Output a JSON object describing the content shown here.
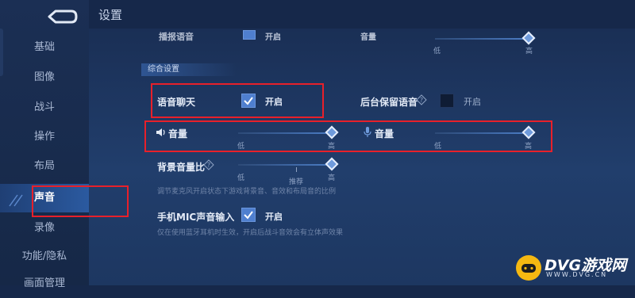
{
  "header": {
    "title": "设置"
  },
  "sidebar": {
    "items": [
      {
        "label": "基础"
      },
      {
        "label": "图像"
      },
      {
        "label": "战斗"
      },
      {
        "label": "操作"
      },
      {
        "label": "布局"
      },
      {
        "label": "声音",
        "active": true
      },
      {
        "label": "录像"
      },
      {
        "label": "功能/隐私"
      },
      {
        "label": "画面管理"
      }
    ]
  },
  "partial_row": {
    "label": "播报语音",
    "checked": true,
    "check_label": "开启",
    "volume_label": "音量",
    "low": "低",
    "high": "高",
    "volume_level": 1.0
  },
  "section": {
    "title": "综合设置"
  },
  "voice_chat": {
    "label": "语音聊天",
    "checked": true,
    "check_label": "开启"
  },
  "background_keep": {
    "label": "后台保留语音",
    "checked": false,
    "check_label": "开启"
  },
  "speaker_volume": {
    "label": "音量",
    "icon": "speaker-icon",
    "low": "低",
    "high": "高",
    "level": 1.0
  },
  "mic_volume": {
    "label": "音量",
    "icon": "microphone-icon",
    "low": "低",
    "high": "高",
    "level": 1.0
  },
  "bg_ratio": {
    "label": "背景音量比",
    "low": "低",
    "high": "高",
    "recommend": "推荐",
    "level": 1.0,
    "desc": "调节麦克风开启状态下游戏背景音、音效和布局音的比例"
  },
  "phone_mic": {
    "label": "手机MIC声音输入",
    "checked": true,
    "check_label": "开启",
    "desc": "仅在使用蓝牙耳机时生效，开启后战斗音效会有立体声效果"
  },
  "watermark": {
    "main": "DVG游戏网",
    "sub": "WWW.DVG.CN"
  },
  "colors": {
    "accent": "#4f7fcf",
    "highlight": "#e8202a",
    "panel": "#213e6c",
    "sidebar": "#1b2f54"
  }
}
